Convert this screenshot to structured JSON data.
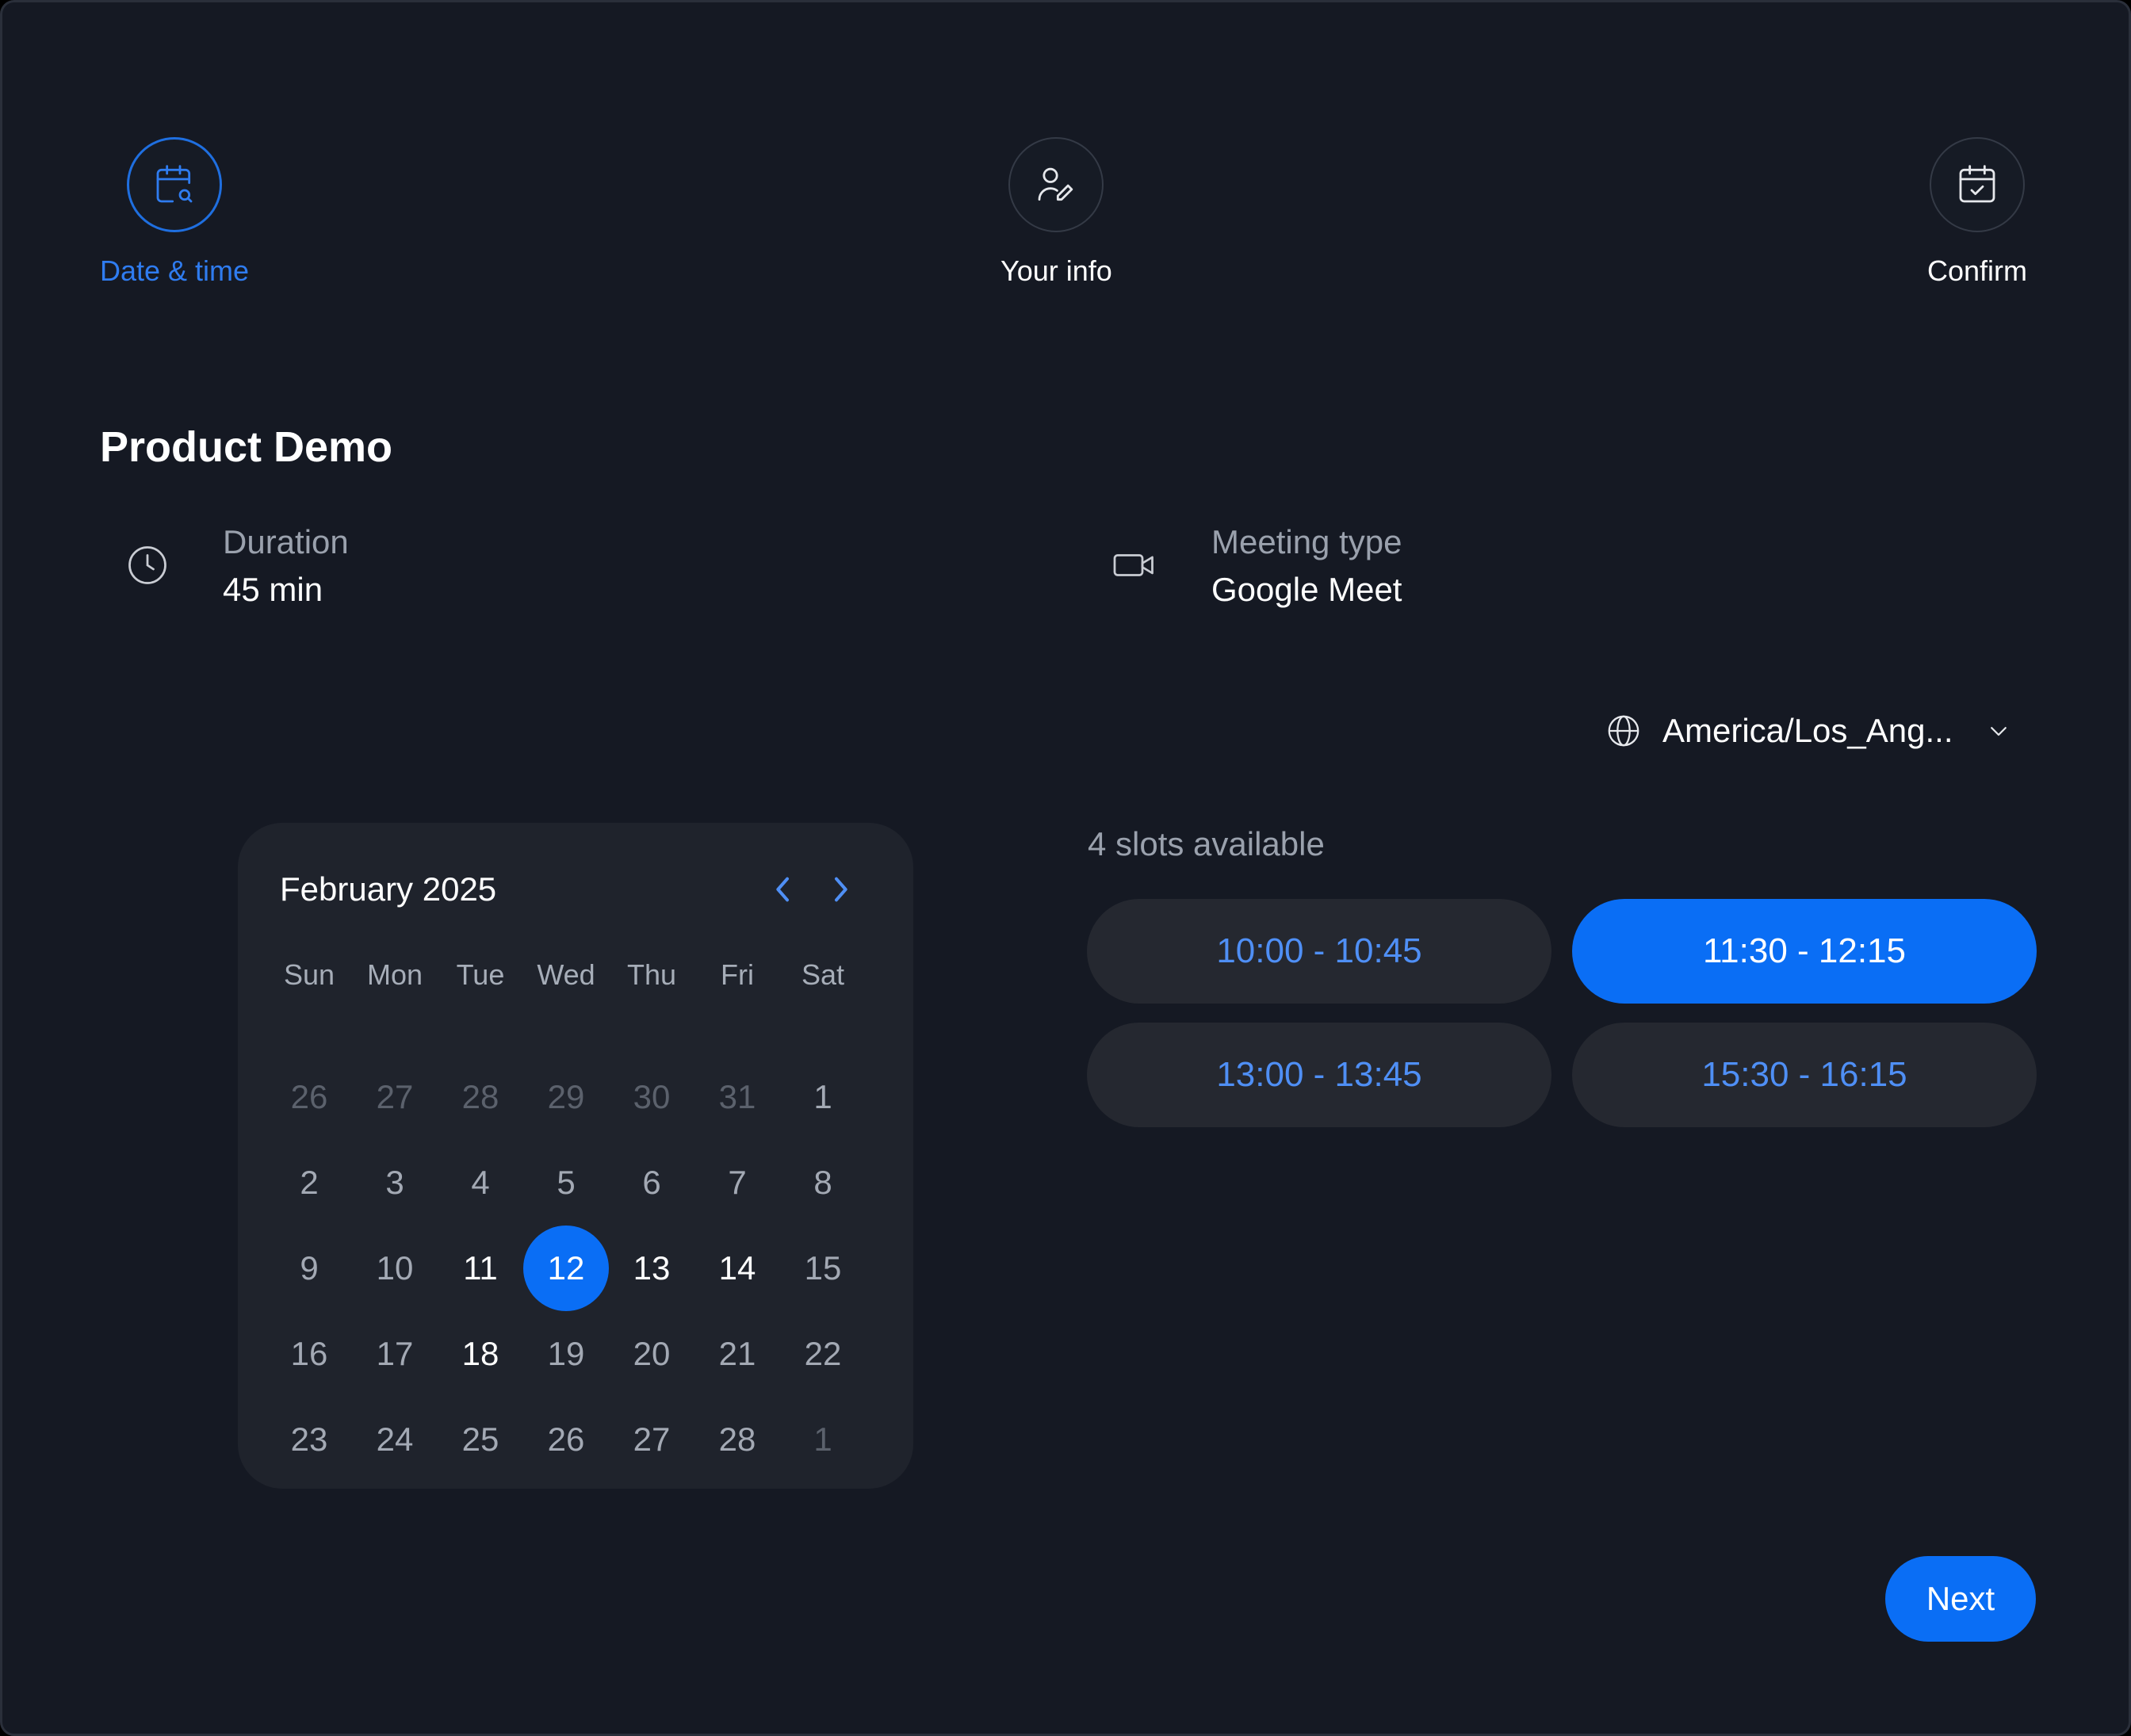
{
  "stepper": {
    "steps": [
      {
        "label": "Date & time",
        "icon": "calendar-search-icon",
        "state": "active"
      },
      {
        "label": "Your info",
        "icon": "user-edit-icon",
        "state": "upcoming"
      },
      {
        "label": "Confirm",
        "icon": "calendar-check-icon",
        "state": "upcoming"
      }
    ]
  },
  "event": {
    "title": "Product Demo",
    "duration_label": "Duration",
    "duration_value": "45 min",
    "meeting_type_label": "Meeting type",
    "meeting_type_value": "Google Meet"
  },
  "timezone": {
    "value": "America/Los_Ang...",
    "icon": "globe-icon"
  },
  "calendar": {
    "month_label": "February 2025",
    "weekdays": [
      "Sun",
      "Mon",
      "Tue",
      "Wed",
      "Thu",
      "Fri",
      "Sat"
    ],
    "weeks": [
      [
        {
          "d": "26",
          "s": "muted"
        },
        {
          "d": "27",
          "s": "muted"
        },
        {
          "d": "28",
          "s": "muted"
        },
        {
          "d": "29",
          "s": "muted"
        },
        {
          "d": "30",
          "s": "muted"
        },
        {
          "d": "31",
          "s": "muted"
        },
        {
          "d": "1",
          "s": "normal"
        }
      ],
      [
        {
          "d": "2",
          "s": "normal"
        },
        {
          "d": "3",
          "s": "normal"
        },
        {
          "d": "4",
          "s": "normal"
        },
        {
          "d": "5",
          "s": "normal"
        },
        {
          "d": "6",
          "s": "normal"
        },
        {
          "d": "7",
          "s": "normal"
        },
        {
          "d": "8",
          "s": "normal"
        }
      ],
      [
        {
          "d": "9",
          "s": "normal"
        },
        {
          "d": "10",
          "s": "normal"
        },
        {
          "d": "11",
          "s": "avail"
        },
        {
          "d": "12",
          "s": "selected"
        },
        {
          "d": "13",
          "s": "avail"
        },
        {
          "d": "14",
          "s": "avail"
        },
        {
          "d": "15",
          "s": "normal"
        }
      ],
      [
        {
          "d": "16",
          "s": "normal"
        },
        {
          "d": "17",
          "s": "normal"
        },
        {
          "d": "18",
          "s": "avail"
        },
        {
          "d": "19",
          "s": "normal"
        },
        {
          "d": "20",
          "s": "normal"
        },
        {
          "d": "21",
          "s": "normal"
        },
        {
          "d": "22",
          "s": "normal"
        }
      ],
      [
        {
          "d": "23",
          "s": "normal"
        },
        {
          "d": "24",
          "s": "normal"
        },
        {
          "d": "25",
          "s": "normal"
        },
        {
          "d": "26",
          "s": "normal"
        },
        {
          "d": "27",
          "s": "normal"
        },
        {
          "d": "28",
          "s": "normal"
        },
        {
          "d": "1",
          "s": "muted"
        }
      ]
    ]
  },
  "slots": {
    "count_label": "4 slots available",
    "items": [
      {
        "label": "10:00 - 10:45",
        "selected": false
      },
      {
        "label": "11:30 - 12:15",
        "selected": true
      },
      {
        "label": "13:00 - 13:45",
        "selected": false
      },
      {
        "label": "15:30 - 16:15",
        "selected": false
      }
    ]
  },
  "actions": {
    "next_label": "Next"
  },
  "colors": {
    "background": "#151923",
    "accent": "#0a6ef5",
    "accent_text": "#2f7cf0",
    "card": "#1f232c"
  }
}
